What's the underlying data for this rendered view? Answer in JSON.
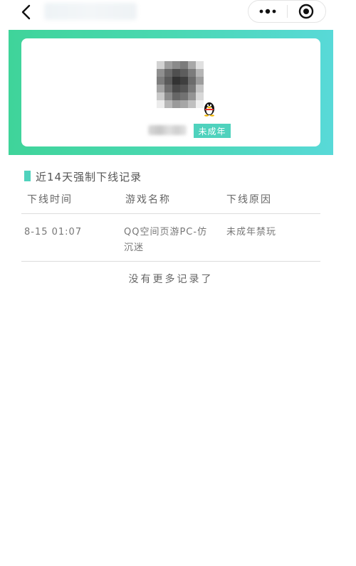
{
  "nav": {
    "back_icon": "chevron-left-icon",
    "more_icon": "more-dots-icon",
    "close_icon": "target-circle-icon"
  },
  "profile": {
    "badge": "未成年"
  },
  "section": {
    "title": "近14天强制下线记录",
    "accent_color": "#4fd2bd"
  },
  "table": {
    "headers": [
      "下线时间",
      "游戏名称",
      "下线原因"
    ],
    "rows": [
      {
        "time": "8-15 01:07",
        "game_line1": "QQ空间页游PC-仿",
        "game_line2": "沉迷",
        "reason": "未成年禁玩"
      }
    ]
  },
  "footer": {
    "no_more": "没有更多记录了"
  },
  "colors": {
    "banner_start": "#3fd49a",
    "banner_end": "#58d9d8",
    "badge_bg": "#4fd2bd"
  }
}
